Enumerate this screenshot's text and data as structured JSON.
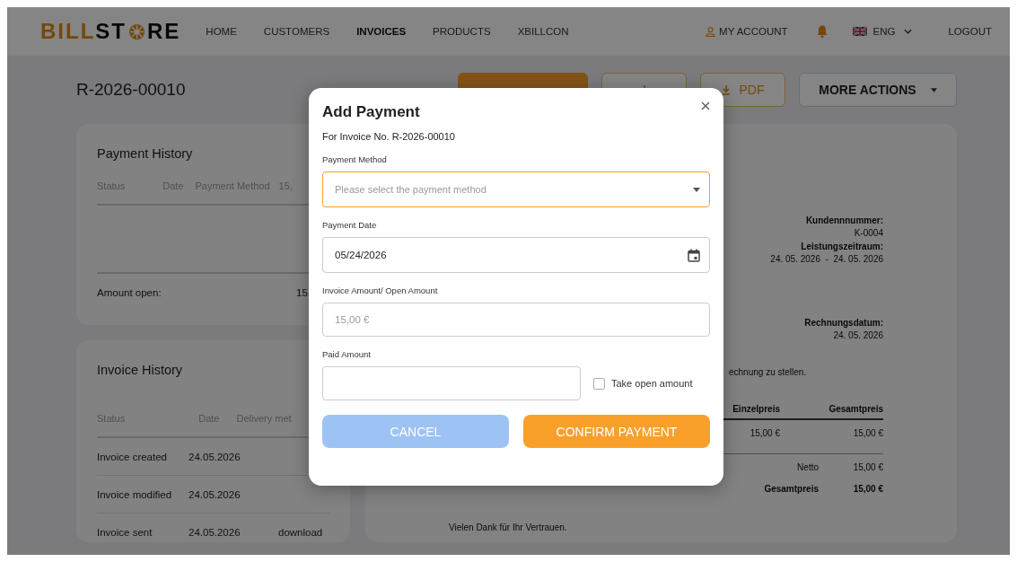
{
  "header": {
    "logo": {
      "part_1": "BILL",
      "part_2": "ST",
      "part_3": "RE"
    },
    "nav": [
      {
        "label": "HOME",
        "selected": false
      },
      {
        "label": "CUSTOMERS",
        "selected": false
      },
      {
        "label": "INVOICES",
        "selected": true
      },
      {
        "label": "PRODUCTS",
        "selected": false
      },
      {
        "label": "XBILLCON",
        "selected": false
      }
    ],
    "account": "MY ACCOUNT",
    "language": "ENG",
    "logout": "LOGOUT"
  },
  "invoice_number": "R-2026-00010",
  "actions": [
    {
      "kind": "primary"
    },
    {
      "kind": "download"
    },
    {
      "label": "PDF",
      "kind": "download"
    },
    {
      "label": "MORE ACTIONS",
      "kind": "dropdown"
    }
  ],
  "payment_history": {
    "title": "Payment History",
    "columns": [
      "Status",
      "Date",
      "Payment Method",
      "15,"
    ],
    "amount_open_label": "Amount open:",
    "amount_open_value": "15,"
  },
  "invoice_history": {
    "title": "Invoice History",
    "columns": [
      "Status",
      "Date",
      "Delivery met"
    ],
    "rows": [
      {
        "status": "Invoice created",
        "date": "24.05.2026",
        "delivery": ""
      },
      {
        "status": "Invoice modified",
        "date": "24.05.2026",
        "delivery": ""
      },
      {
        "status": "Invoice sent",
        "date": "24.05.2026",
        "delivery": "download"
      }
    ]
  },
  "preview": {
    "field_groups": [
      [
        {
          "label": "Kundennnummer:",
          "value": "K-0004"
        },
        {
          "label": "Leistungszeitraum:",
          "value": "24. 05. 2026  -  24. 05. 2026"
        }
      ],
      [
        {
          "label": "Rechnungsdatum:",
          "value": "24. 05. 2026"
        }
      ]
    ],
    "intro": "echnung zu stellen.",
    "table_columns": [
      "Einzelpreis",
      "Gesamtpreis"
    ],
    "table_rows": [
      [
        "15,00 €",
        "15,00 €"
      ]
    ],
    "net_label": "Netto",
    "net_value": "15,00 €",
    "total_label": "Gesamtpreis",
    "total_value": "15,00 €",
    "closing": "Vielen Dank für Ihr Vertrauen."
  },
  "modal": {
    "title": "Add Payment",
    "subtitle": "For Invoice No. R-2026-00010",
    "fields": [
      {
        "kind": "select",
        "label": "Payment Method",
        "placeholder": "Please select the payment method",
        "focused": true,
        "disabled": false
      },
      {
        "kind": "date",
        "label": "Payment Date",
        "value": "05/24/2026",
        "focused": false,
        "disabled": false
      },
      {
        "kind": "text",
        "label": "Invoice Amount/ Open Amount",
        "value": "15,00 €",
        "focused": false,
        "disabled": true
      }
    ],
    "paid_amount": {
      "label": "Paid Amount"
    },
    "take_open_amount": {
      "label": "Take open amount",
      "checked": false
    },
    "buttons": [
      {
        "label": "CANCEL",
        "kind": "secondary"
      },
      {
        "label": "CONFIRM PAYMENT",
        "kind": "primary"
      }
    ]
  }
}
